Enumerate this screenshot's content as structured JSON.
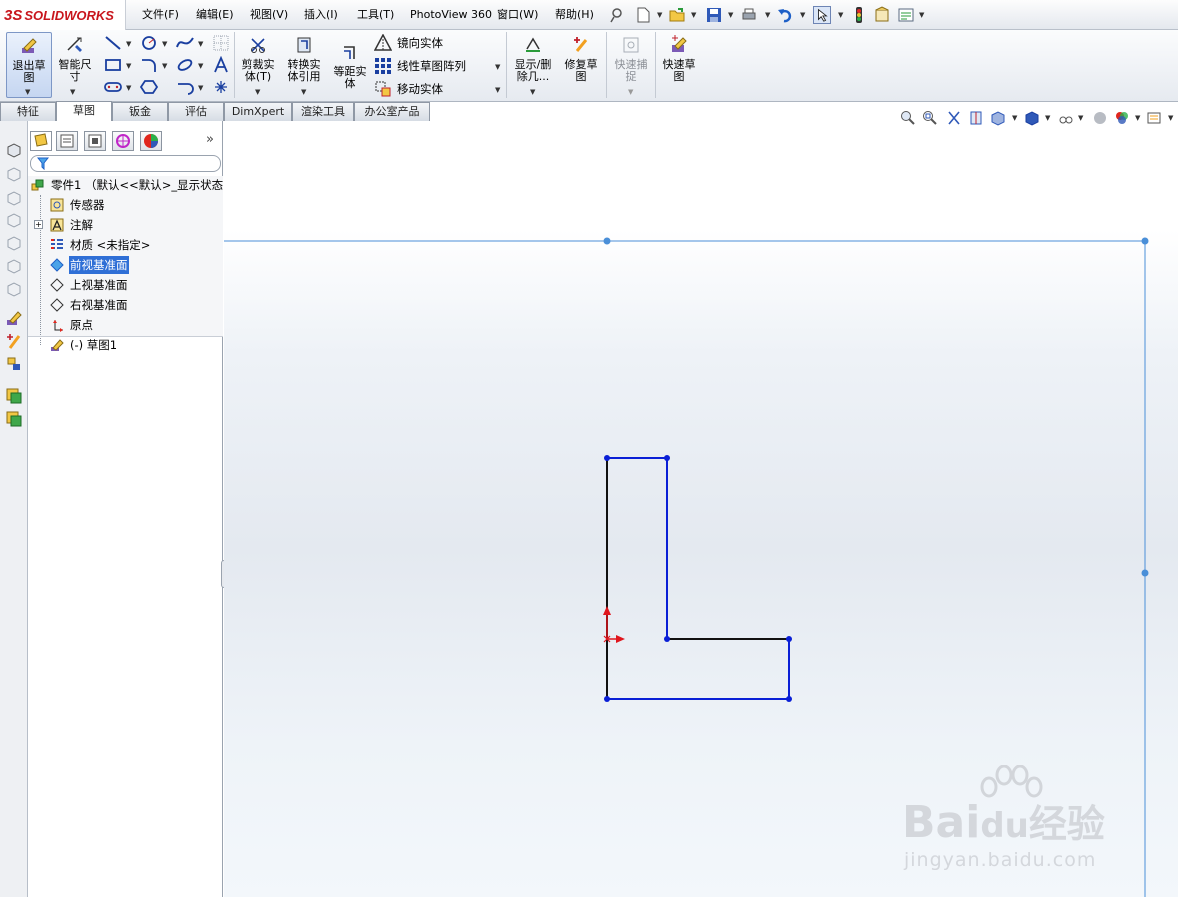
{
  "app": {
    "logo_ds": "3S",
    "logo_text": "SOLIDWORKS"
  },
  "menu": [
    "文件(F)",
    "编辑(E)",
    "视图(V)",
    "插入(I)",
    "工具(T)",
    "PhotoView 360",
    "窗口(W)",
    "帮助(H)"
  ],
  "ribbon": {
    "exit_sketch": "退出草\n图",
    "smart_dim": "智能尺\n寸",
    "trim": "剪裁实\n体(T)",
    "convert": "转换实\n体引用",
    "offset": "等距实\n体",
    "mirror": "镜向实体",
    "linear_pattern": "线性草图阵列",
    "move": "移动实体",
    "display_delete": "显示/删\n除几...",
    "repair": "修复草\n图",
    "quick_snap": "快速捕\n捉",
    "rapid_sketch": "快速草\n图"
  },
  "tabs": [
    "特征",
    "草图",
    "钣金",
    "评估",
    "DimXpert",
    "渲染工具",
    "办公室产品"
  ],
  "active_tab": 1,
  "tree": {
    "root": "零件1 （默认<<默认>_显示状态",
    "items": [
      "传感器",
      "注解",
      "材质 <未指定>",
      "前视基准面",
      "上视基准面",
      "右视基准面",
      "原点",
      "(-) 草图1"
    ],
    "selected": 3,
    "expand_more": "»"
  },
  "watermark": {
    "brand_a": "Bai",
    "brand_b": "du",
    "brand_c": "经验",
    "url": "jingyan.baidu.com"
  },
  "colors": {
    "sketch_blue": "#0a1fd6",
    "sketch_black": "#111111",
    "plane": "#4a8fd8",
    "origin": "#e0161d"
  }
}
